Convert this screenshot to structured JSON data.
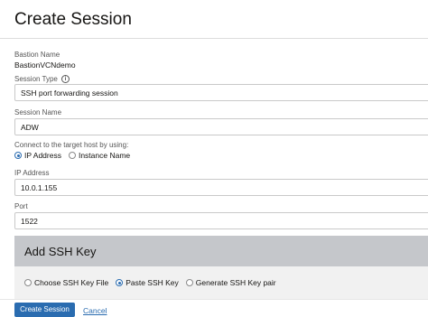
{
  "header": {
    "title": "Create Session"
  },
  "bastion": {
    "label": "Bastion Name",
    "value": "BastionVCNdemo"
  },
  "session_type": {
    "label": "Session Type",
    "value": "SSH port forwarding session",
    "info_icon": "info-icon"
  },
  "session_name": {
    "label": "Session Name",
    "value": "ADW"
  },
  "connect": {
    "label": "Connect to the target host by using:",
    "options": [
      {
        "label": "IP Address",
        "checked": true
      },
      {
        "label": "Instance Name",
        "checked": false
      }
    ]
  },
  "ip_address": {
    "label": "IP Address",
    "value": "10.0.1.155"
  },
  "port": {
    "label": "Port",
    "value": "1522"
  },
  "ssh_key": {
    "title": "Add SSH Key",
    "options": [
      {
        "label": "Choose SSH Key File",
        "checked": false
      },
      {
        "label": "Paste SSH Key",
        "checked": true
      },
      {
        "label": "Generate SSH Key pair",
        "checked": false
      }
    ]
  },
  "footer": {
    "create_label": "Create Session",
    "cancel_label": "Cancel"
  },
  "colors": {
    "accent": "#2a6cb0",
    "panel_header": "#c5c7cb",
    "panel_body": "#f1f1f1"
  }
}
